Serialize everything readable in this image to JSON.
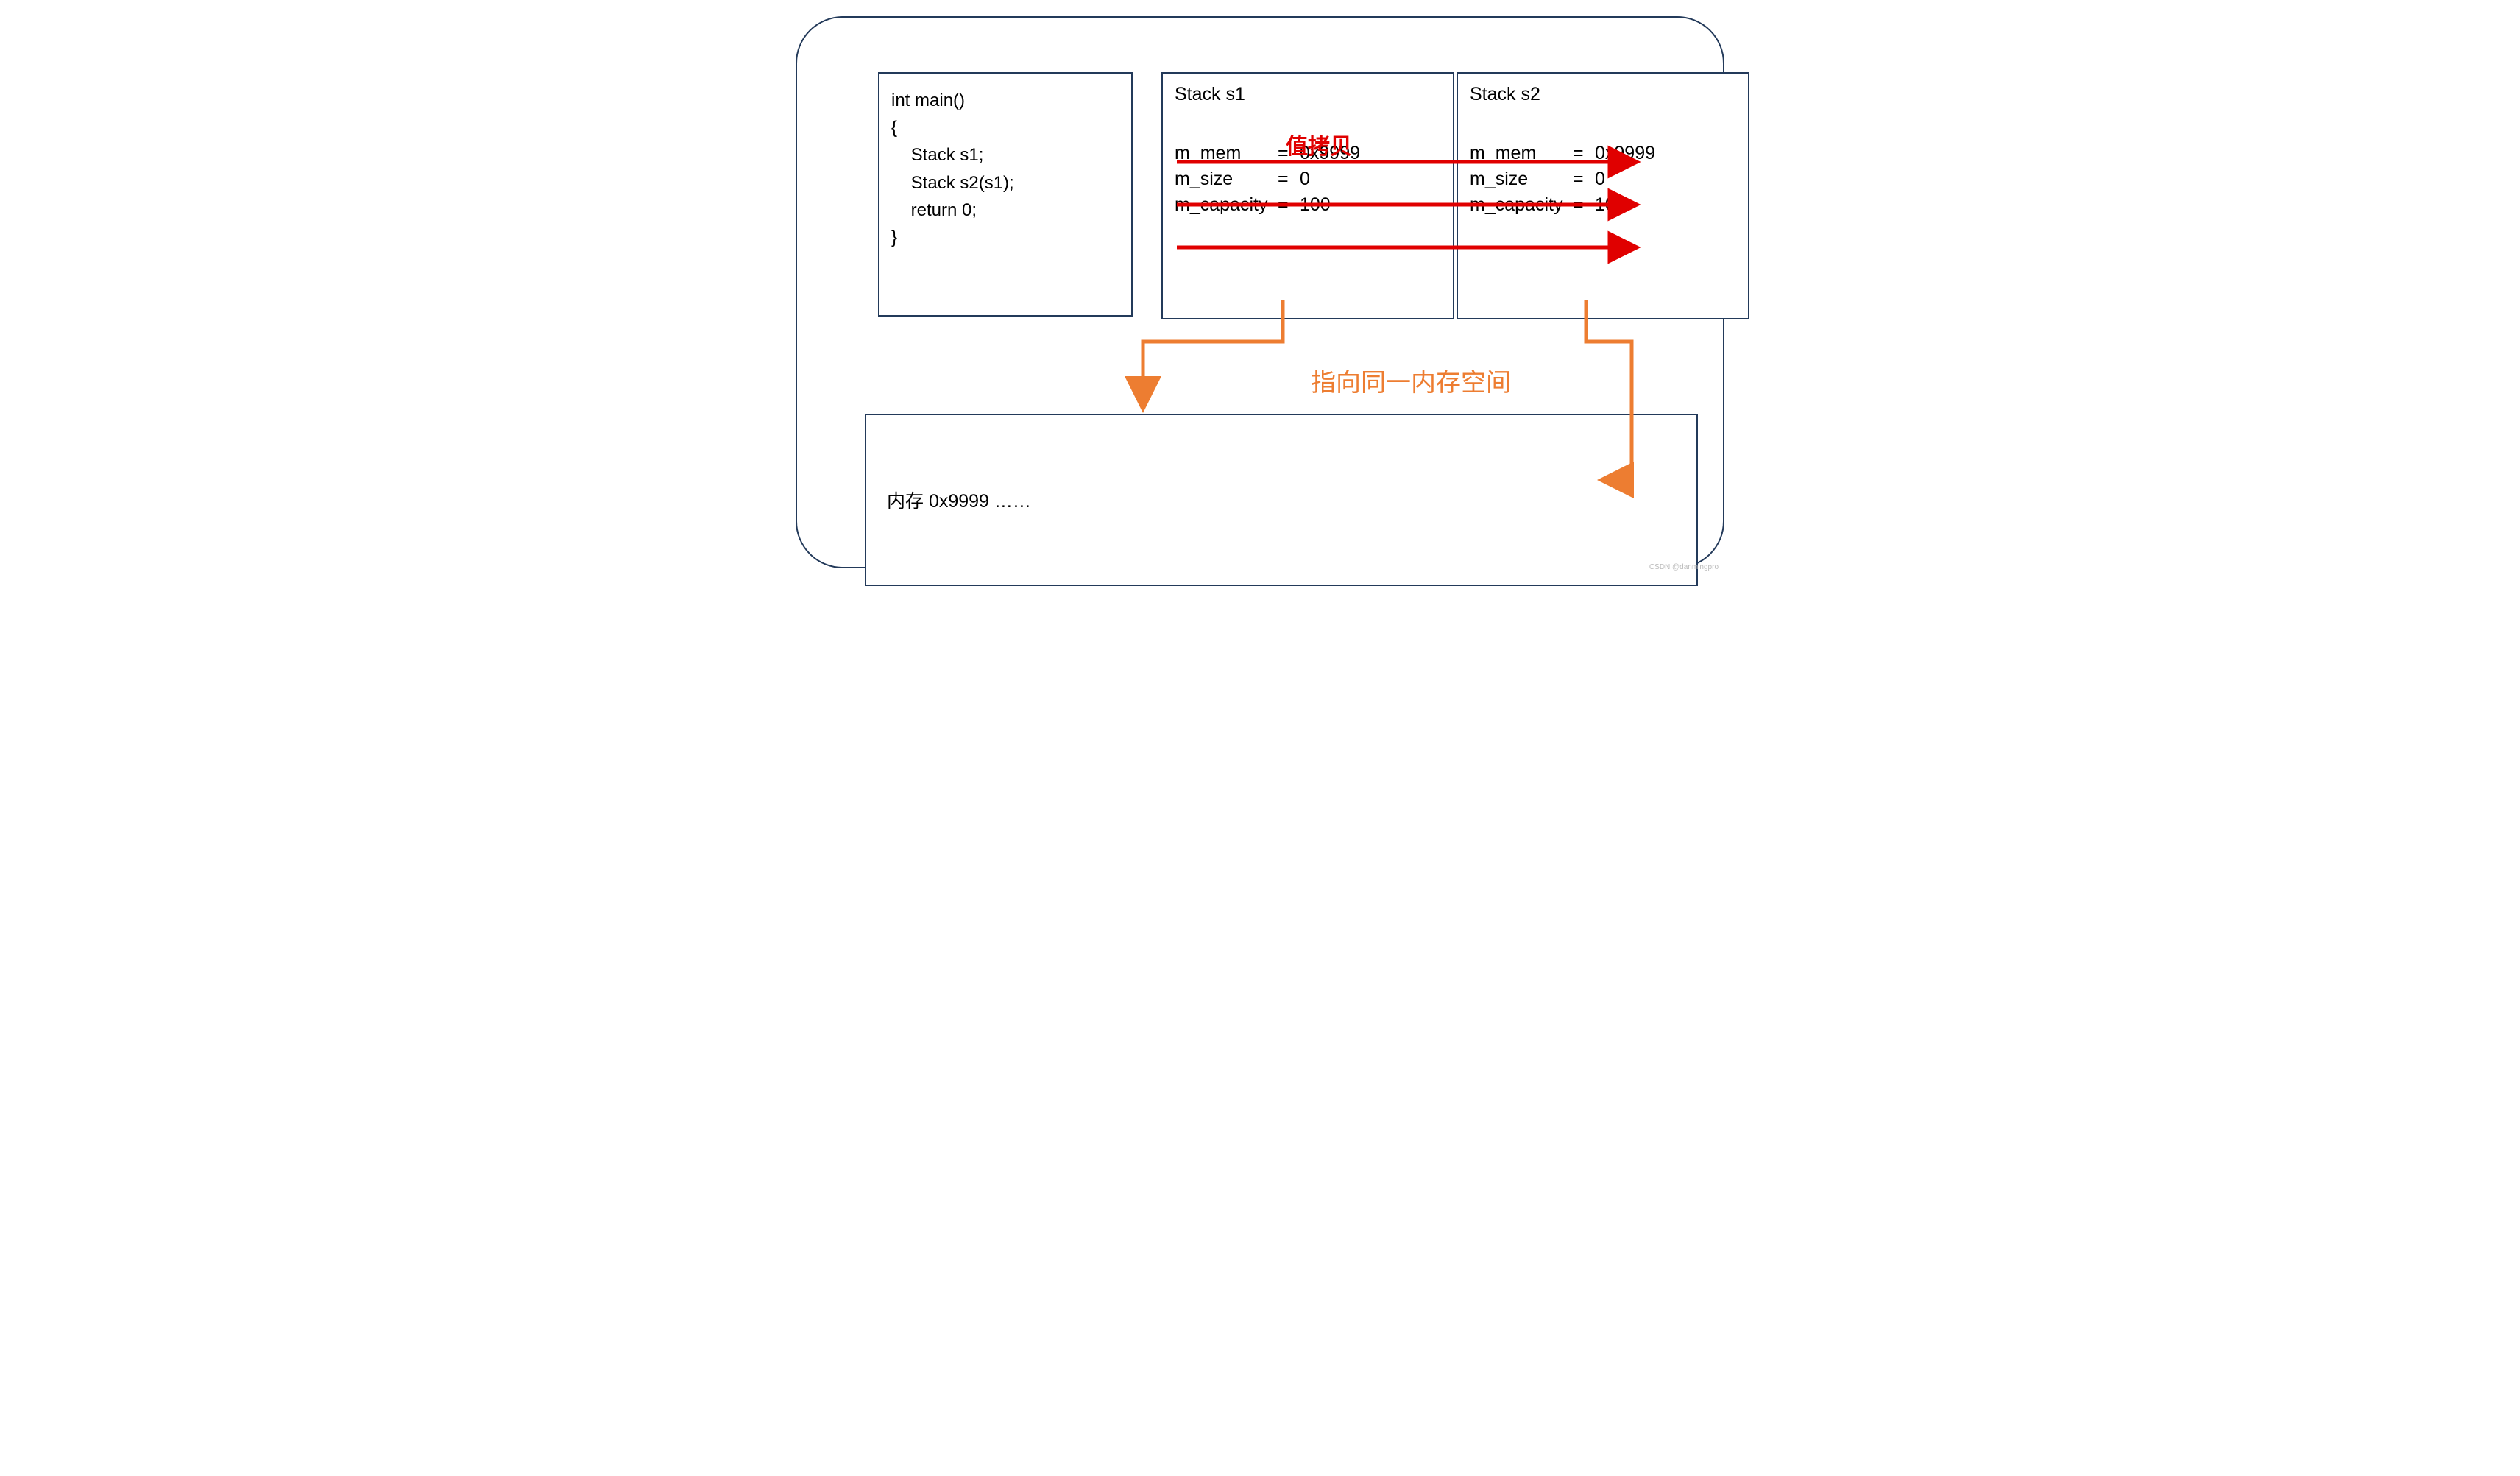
{
  "code": {
    "line1": "int main()",
    "line2": "{",
    "line3": "    Stack s1;",
    "line4": "    Stack s2(s1);",
    "line5": "    return 0;",
    "line6": "}"
  },
  "stack1": {
    "title": "Stack s1",
    "mem_k": "m_mem",
    "mem_eq": "=",
    "mem_v": "0x9999",
    "size_k": "m_size",
    "size_eq": "=",
    "size_v": "0",
    "cap_k": "m_capacity",
    "cap_eq": "=",
    "cap_v": "100"
  },
  "stack2": {
    "title": "Stack s2",
    "mem_k": "m_mem",
    "mem_eq": "=",
    "mem_v": "0x9999",
    "size_k": "m_size",
    "size_eq": "=",
    "size_v": "0",
    "cap_k": "m_capacity",
    "cap_eq": "=",
    "cap_v": "100"
  },
  "labels": {
    "copy": "值拷贝",
    "point": "指向同一内存空间"
  },
  "memory": {
    "text": "内存  0x9999 ……"
  },
  "watermark": "CSDN @danmingpro",
  "colors": {
    "border": "#233a5a",
    "red": "#e00000",
    "orange": "#ed7d31"
  }
}
